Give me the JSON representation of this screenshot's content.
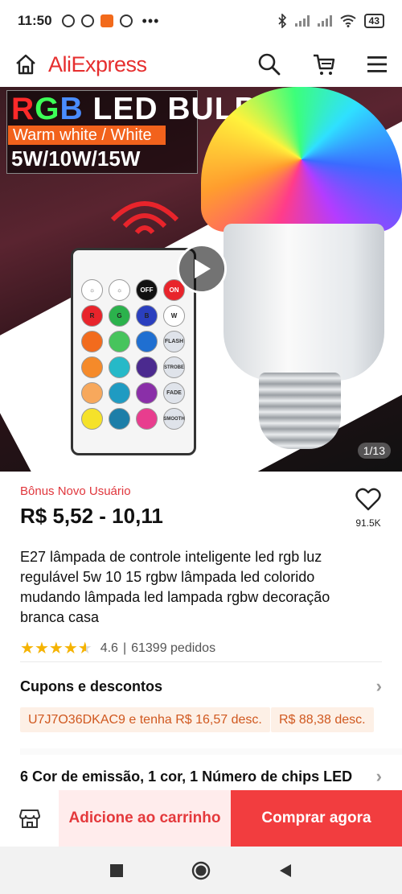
{
  "status_bar": {
    "time": "11:50",
    "battery": "43"
  },
  "header": {
    "logo": "AliExpress",
    "icons": [
      "home-icon",
      "search-icon",
      "cart-icon",
      "menu-icon"
    ]
  },
  "gallery": {
    "banner_title_r": "R",
    "banner_title_g": "G",
    "banner_title_b": "B",
    "banner_title_rest": " LED BULB",
    "banner_subtitle": "Warm white / White",
    "banner_wattage": "5W/10W/15W",
    "remote_labels": {
      "off": "OFF",
      "on": "ON",
      "r": "R",
      "g": "G",
      "b": "B",
      "w": "W",
      "flash": "FLASH",
      "strobe": "STROBE",
      "fade": "FADE",
      "smooth": "SMOOTH"
    },
    "counter": "1/13"
  },
  "product": {
    "bonus_label": "Bônus Novo Usuário",
    "price": "R$ 5,52 - 10,11",
    "wishlist_count": "91.5K",
    "title": "E27 lâmpada de controle inteligente led rgb luz regulável 5w 10 15 rgbw lâmpada led colorido mudando lâmpada led lampada rgbw decoração branca casa",
    "rating": "4.6",
    "rating_fraction": 0.92,
    "separator": "|",
    "orders": "61399 pedidos"
  },
  "coupons": {
    "heading": "Cupons e descontos",
    "tags": [
      "U7J7O36DKAC9 e tenha R$ 16,57 desc.",
      "R$ 88,38 desc."
    ]
  },
  "variant": {
    "label": "6 Cor de emissão, 1 cor, 1 Número de chips LED"
  },
  "action_bar": {
    "add_to_cart": "Adicione ao carrinho",
    "buy_now": "Comprar agora"
  },
  "colors": {
    "brand_red": "#e62e2e",
    "buy_red": "#f23d3f",
    "coupon_orange": "#d0581f",
    "star": "#f5b301"
  }
}
